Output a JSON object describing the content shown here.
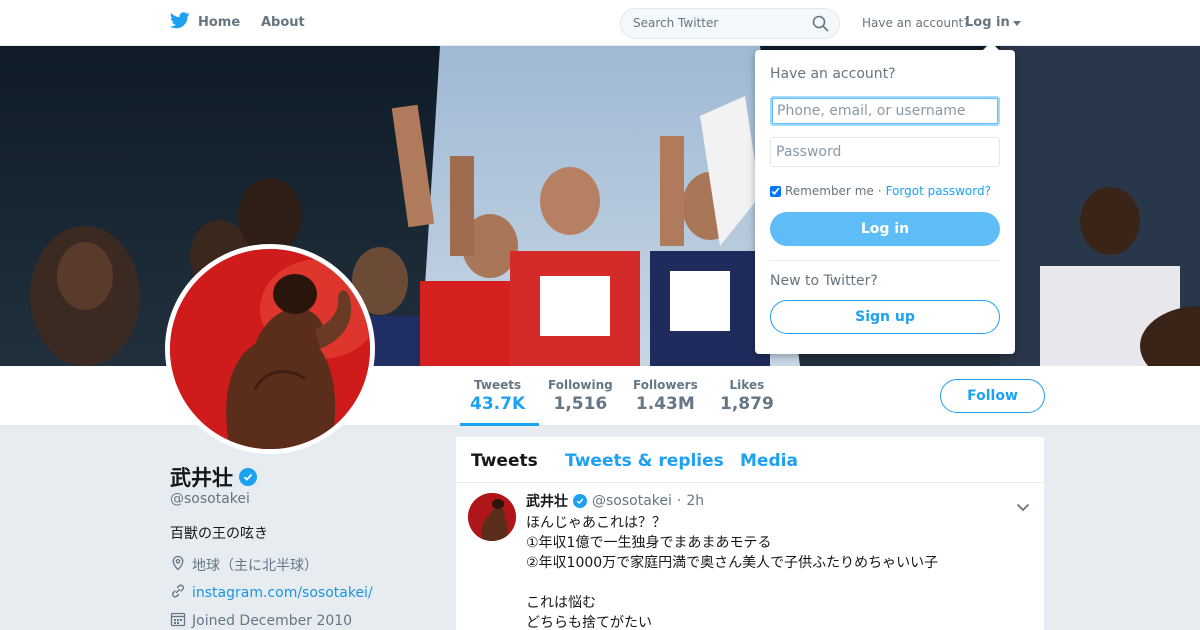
{
  "nav": {
    "home_label": "Home",
    "about_label": "About",
    "search_placeholder": "Search Twitter",
    "have_account": "Have an account?",
    "login_label": "Log in"
  },
  "profile": {
    "name": "武井壮",
    "screen_name": "@sosotakei",
    "bio": "百獣の王の呟き",
    "location": "地球（主に北半球）",
    "url": "instagram.com/sosotakei/",
    "joined": "Joined December 2010",
    "verified": true
  },
  "stats": [
    {
      "label": "Tweets",
      "value": "43.7K",
      "active": true
    },
    {
      "label": "Following",
      "value": "1,516"
    },
    {
      "label": "Followers",
      "value": "1.43M"
    },
    {
      "label": "Likes",
      "value": "1,879"
    }
  ],
  "follow_label": "Follow",
  "timeline": {
    "tabs": [
      "Tweets",
      "Tweets & replies",
      "Media"
    ],
    "tweet": {
      "name": "武井壮",
      "screen_name": "@sosotakei",
      "time": "2h",
      "text": "ほんじゃあこれは？？\n①年収1億で一生独身でまあまあモテる\n②年収1000万で家庭円満で奥さん美人で子供ふたりめちゃいい子\n\nこれは悩む\nどちらも捨てがたい"
    }
  },
  "login_dropdown": {
    "title": "Have an account?",
    "username_placeholder": "Phone, email, or username",
    "password_placeholder": "Password",
    "remember_me": "Remember me",
    "separator": "·",
    "forgot_password": "Forgot password?",
    "login_button": "Log in",
    "new_to_twitter": "New to Twitter?",
    "signup_button": "Sign up"
  },
  "colors": {
    "accent": "#1da1f2",
    "text": "#14171a",
    "muted": "#657786",
    "background": "#e6ecf0"
  }
}
